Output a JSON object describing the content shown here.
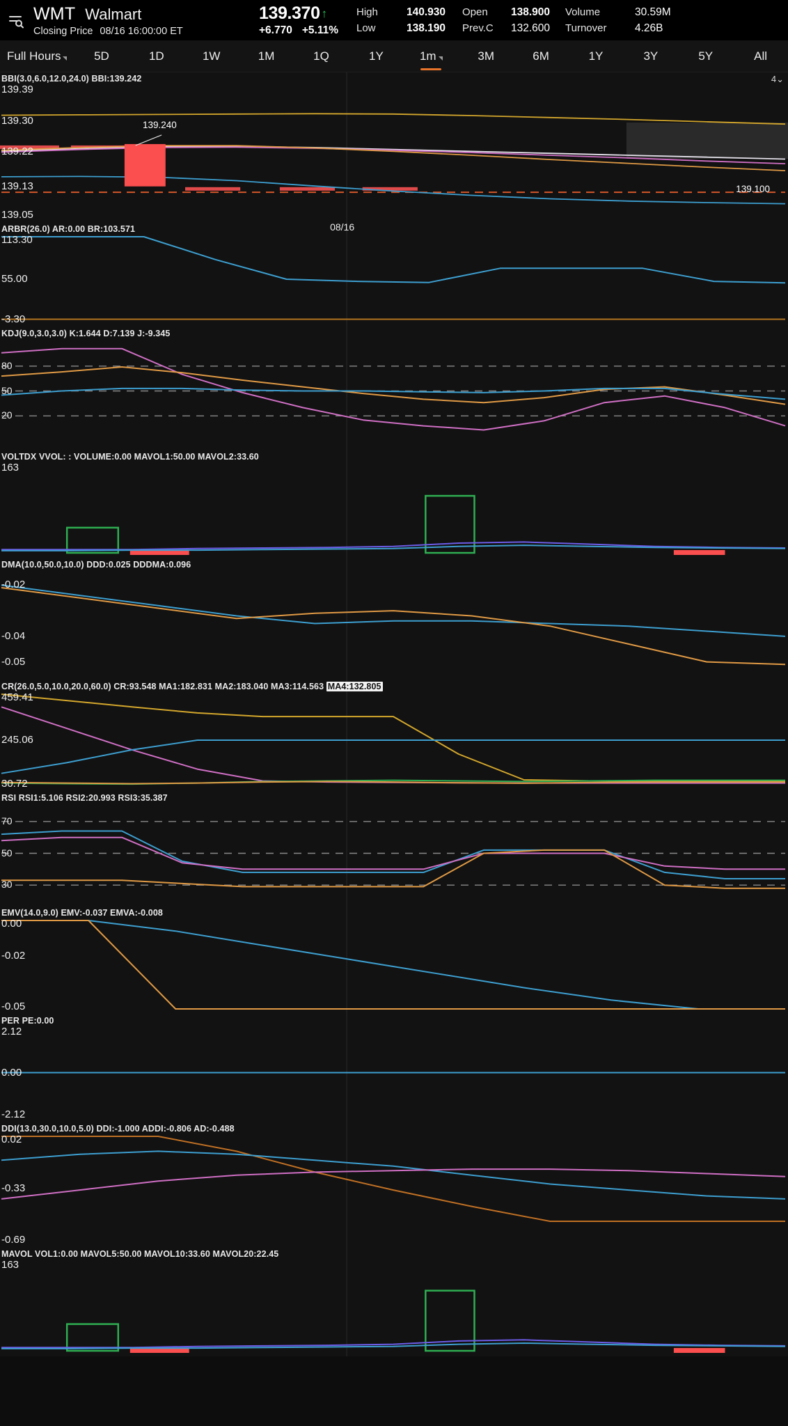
{
  "header": {
    "menu_icon": "menu-search-icon",
    "ticker": "WMT",
    "company": "Walmart",
    "status_label": "Closing Price",
    "timestamp": "08/16 16:00:00 ET",
    "price": "139.370",
    "arrow": "↑",
    "change": "+6.770",
    "change_pct": "+5.11%",
    "up_color": "#25c75a",
    "stats": [
      {
        "label": "High",
        "value": "140.930"
      },
      {
        "label": "Low",
        "value": "138.190"
      },
      {
        "label": "Open",
        "value": "138.900"
      },
      {
        "label": "Prev.C",
        "value": "132.600"
      },
      {
        "label": "Volume",
        "value": "30.59M"
      },
      {
        "label": "Turnover",
        "value": "4.26B"
      }
    ]
  },
  "tabs": {
    "accent": "#e8732a",
    "items": [
      {
        "label": "Full Hours",
        "caret": true,
        "active": false
      },
      {
        "label": "5D",
        "caret": false,
        "active": false
      },
      {
        "label": "1D",
        "caret": false,
        "active": false
      },
      {
        "label": "1W",
        "caret": false,
        "active": false
      },
      {
        "label": "1M",
        "caret": false,
        "active": false
      },
      {
        "label": "1Q",
        "caret": false,
        "active": false
      },
      {
        "label": "1Y",
        "caret": false,
        "active": false
      },
      {
        "label": "1m",
        "caret": true,
        "active": true
      },
      {
        "label": "3M",
        "caret": false,
        "active": false
      },
      {
        "label": "6M",
        "caret": false,
        "active": false
      },
      {
        "label": "1Y",
        "caret": false,
        "active": false
      },
      {
        "label": "3Y",
        "caret": false,
        "active": false
      },
      {
        "label": "5Y",
        "caret": false,
        "active": false
      },
      {
        "label": "All",
        "caret": false,
        "active": false
      }
    ]
  },
  "chart_data": [
    {
      "id": "price",
      "type": "line",
      "title": "BBI(3.0,6.0,12.0,24.0)  BBI:139.242",
      "indicator": "BBI",
      "params": "3.0,6.0,12.0,24.0",
      "readouts": [
        {
          "name": "BBI",
          "value": "139.242"
        }
      ],
      "yticks": [
        "139.39",
        "139.30",
        "139.22",
        "139.13",
        "139.05"
      ],
      "ylim": [
        139.05,
        139.39
      ],
      "grid": false,
      "xlabel": "08/16",
      "annotation": "139.240",
      "axis_badge": "139.100",
      "series": [
        {
          "name": "BBI-upper",
          "color": "#d4a72c",
          "values": [
            139.315,
            139.316,
            139.317,
            139.318,
            139.319,
            139.318,
            139.314,
            139.309,
            139.304,
            139.298,
            139.292
          ]
        },
        {
          "name": "MA-white",
          "color": "#e8e4ee",
          "values": [
            139.222,
            139.228,
            139.233,
            139.234,
            139.231,
            139.226,
            139.221,
            139.216,
            139.211,
            139.206,
            139.201
          ]
        },
        {
          "name": "MA-pink",
          "color": "#cf6fc4",
          "values": [
            139.219,
            139.226,
            139.231,
            139.232,
            139.229,
            139.224,
            139.218,
            139.211,
            139.204,
            139.196,
            139.189
          ]
        },
        {
          "name": "MA-orange",
          "color": "#e09a45",
          "values": [
            139.224,
            139.231,
            139.236,
            139.236,
            139.23,
            139.221,
            139.211,
            139.2,
            139.19,
            139.18,
            139.171
          ]
        },
        {
          "name": "MA-cyan",
          "color": "#3d9fd0",
          "values": [
            139.155,
            139.156,
            139.154,
            139.145,
            139.131,
            139.118,
            139.107,
            139.098,
            139.092,
            139.088,
            139.085
          ]
        }
      ],
      "candle": {
        "color": "#fb4e4e",
        "open": 139.24,
        "close": 139.13
      },
      "dashed_line": {
        "color": "#d4572a",
        "value": 139.115
      }
    },
    {
      "id": "arbr",
      "type": "line",
      "title": "ARBR(26.0)  AR:0.00  BR:103.571",
      "indicator": "ARBR",
      "params": "26.0",
      "readouts": [
        {
          "name": "AR",
          "value": "0.00"
        },
        {
          "name": "BR",
          "value": "103.571"
        }
      ],
      "yticks": [
        "113.30",
        "55.00",
        "-3.30"
      ],
      "ylim": [
        -3.3,
        113.3
      ],
      "series": [
        {
          "name": "BR",
          "color": "#3d9fd0",
          "values": [
            113.3,
            113.3,
            113.3,
            82.0,
            55.0,
            52.0,
            50.5,
            70.0,
            70.0,
            70.0,
            52.0,
            50.0
          ]
        },
        {
          "name": "AR",
          "color": "#b5751f",
          "values": [
            0,
            0,
            0,
            0,
            0,
            0,
            0,
            0,
            0,
            0,
            0,
            0
          ]
        }
      ]
    },
    {
      "id": "kdj",
      "type": "line",
      "title": "KDJ(9.0,3.0,3.0)  K:1.644  D:7.139  J:-9.345",
      "indicator": "KDJ",
      "params": "9.0,3.0,3.0",
      "readouts": [
        {
          "name": "K",
          "value": "1.644"
        },
        {
          "name": "D",
          "value": "7.139"
        },
        {
          "name": "J",
          "value": "-9.345"
        }
      ],
      "yticks": [
        "80",
        "50",
        "20"
      ],
      "ylim": [
        -15,
        110
      ],
      "grid": true,
      "series": [
        {
          "name": "J",
          "color": "#cf6fc4",
          "values": [
            96,
            101,
            101,
            70,
            48,
            30,
            15,
            8,
            3,
            14,
            36,
            44,
            30,
            8
          ]
        },
        {
          "name": "D",
          "color": "#e09a45",
          "values": [
            68,
            73,
            79,
            72,
            63,
            55,
            47,
            40,
            36,
            42,
            52,
            55,
            45,
            34
          ]
        },
        {
          "name": "K",
          "color": "#3d9fd0",
          "values": [
            45,
            50,
            53,
            53,
            51,
            50,
            50,
            49,
            48,
            50,
            53,
            53,
            46,
            40
          ]
        }
      ]
    },
    {
      "id": "voltdx",
      "type": "bar",
      "title": "VOLTDX VVOL: :  VOLUME:0.00  MAVOL1:50.00  MAVOL2:33.60",
      "indicator": "VOLTDX",
      "readouts": [
        {
          "name": "VOLUME",
          "value": "0.00"
        },
        {
          "name": "MAVOL1",
          "value": "50.00"
        },
        {
          "name": "MAVOL2",
          "value": "33.60"
        }
      ],
      "yticks": [
        "163"
      ],
      "ylim": [
        0,
        163
      ],
      "boxes": [
        {
          "x": 0.085,
          "w": 0.065,
          "h": 0.38,
          "color": "#2fae52"
        },
        {
          "x": 0.54,
          "w": 0.062,
          "h": 0.86,
          "color": "#2fae52"
        }
      ],
      "red_bars": [
        {
          "x": 0.165,
          "w": 0.075
        },
        {
          "x": 0.855,
          "w": 0.065
        }
      ],
      "series": [
        {
          "name": "MAVOL1",
          "color": "#6c5ce7",
          "values": [
            6,
            6,
            6,
            8,
            9,
            10,
            12,
            18,
            20,
            16,
            12,
            10,
            9
          ]
        },
        {
          "name": "MAVOL2",
          "color": "#3d9fd0",
          "values": [
            4,
            4,
            5,
            5,
            6,
            7,
            8,
            12,
            14,
            12,
            10,
            9,
            8
          ]
        }
      ]
    },
    {
      "id": "dma",
      "type": "line",
      "title": "DMA(10.0,50.0,10.0)  DDD:0.025  DDDMA:0.096",
      "indicator": "DMA",
      "params": "10.0,50.0,10.0",
      "readouts": [
        {
          "name": "DDD",
          "value": "0.025"
        },
        {
          "name": "DDDMA",
          "value": "0.096"
        }
      ],
      "yticks": [
        "-0.02",
        "-0.04",
        "-0.05"
      ],
      "ylim": [
        -0.055,
        -0.015
      ],
      "series": [
        {
          "name": "DDD",
          "color": "#3d9fd0",
          "values": [
            -0.02,
            -0.024,
            -0.028,
            -0.032,
            -0.035,
            -0.034,
            -0.034,
            -0.035,
            -0.036,
            -0.038,
            -0.04
          ]
        },
        {
          "name": "DDDMA",
          "color": "#e09a45",
          "values": [
            -0.021,
            -0.025,
            -0.029,
            -0.033,
            -0.031,
            -0.03,
            -0.032,
            -0.036,
            -0.043,
            -0.05,
            -0.051
          ]
        }
      ]
    },
    {
      "id": "cr",
      "type": "line",
      "title": "CR(26.0,5.0,10.0,20.0,60.0)  CR:93.548  MA1:182.831  MA2:183.040  MA3:114.563  MA4:132.805",
      "indicator": "CR",
      "params": "26.0,5.0,10.0,20.0,60.0",
      "readouts": [
        {
          "name": "CR",
          "value": "93.548"
        },
        {
          "name": "MA1",
          "value": "182.831"
        },
        {
          "name": "MA2",
          "value": "183.040"
        },
        {
          "name": "MA3",
          "value": "114.563"
        },
        {
          "name": "MA4",
          "value": "132.805",
          "highlight": true
        }
      ],
      "yticks": [
        "459.41",
        "245.06",
        "30.72"
      ],
      "ylim": [
        30.72,
        459.41
      ],
      "series": [
        {
          "name": "MA-gold",
          "color": "#d4a72c",
          "values": [
            459.4,
            430,
            400,
            372,
            355,
            355,
            355,
            180,
            60,
            55,
            55,
            55,
            55
          ]
        },
        {
          "name": "MA-pink",
          "color": "#cf6fc4",
          "values": [
            400,
            300,
            200,
            110,
            55,
            50,
            48,
            46,
            45,
            45,
            45,
            45,
            45
          ]
        },
        {
          "name": "MA-cyan",
          "color": "#3d9fd0",
          "values": [
            90,
            140,
            200,
            245,
            245,
            245,
            245,
            245,
            245,
            245,
            245,
            245,
            245
          ]
        },
        {
          "name": "MA-green",
          "color": "#2fae52",
          "values": [
            45,
            42,
            40,
            45,
            52,
            55,
            58,
            55,
            52,
            55,
            58,
            58,
            58
          ]
        },
        {
          "name": "CR",
          "color": "#e09a45",
          "values": [
            48,
            45,
            42,
            45,
            50,
            52,
            50,
            46,
            44,
            48,
            50,
            50,
            50
          ]
        }
      ]
    },
    {
      "id": "rsi",
      "type": "line",
      "title": "RSI  RSI1:5.106  RSI2:20.993  RSI3:35.387",
      "indicator": "RSI",
      "readouts": [
        {
          "name": "RSI1",
          "value": "5.106"
        },
        {
          "name": "RSI2",
          "value": "20.993"
        },
        {
          "name": "RSI3",
          "value": "35.387"
        }
      ],
      "yticks": [
        "70",
        "50",
        "30"
      ],
      "ylim": [
        20,
        80
      ],
      "grid": true,
      "series": [
        {
          "name": "RSI1",
          "color": "#3d9fd0",
          "values": [
            62,
            64,
            64,
            45,
            38,
            38,
            38,
            38,
            52,
            52,
            52,
            38,
            34,
            34
          ]
        },
        {
          "name": "RSI2",
          "color": "#cf6fc4",
          "values": [
            58,
            60,
            60,
            44,
            40,
            40,
            40,
            40,
            50,
            50,
            50,
            42,
            40,
            40
          ]
        },
        {
          "name": "RSI3",
          "color": "#e09a45",
          "values": [
            33,
            33,
            33,
            31,
            29,
            29,
            29,
            29,
            50,
            52,
            52,
            30,
            28,
            28
          ]
        }
      ]
    },
    {
      "id": "emv",
      "type": "line",
      "title": "EMV(14.0,9.0)  EMV:-0.037  EMVA:-0.008",
      "indicator": "EMV",
      "params": "14.0,9.0",
      "readouts": [
        {
          "name": "EMV",
          "value": "-0.037"
        },
        {
          "name": "EMVA",
          "value": "-0.008"
        }
      ],
      "yticks": [
        "0.00",
        "-0.02",
        "-0.05"
      ],
      "ylim": [
        -0.05,
        0.0
      ],
      "series": [
        {
          "name": "EMV",
          "color": "#3d9fd0",
          "values": [
            0.0,
            0.0,
            -0.006,
            -0.014,
            -0.022,
            -0.03,
            -0.038,
            -0.045,
            -0.05,
            -0.05
          ]
        },
        {
          "name": "EMVA",
          "color": "#e09a45",
          "values": [
            0.0,
            0.0,
            -0.05,
            -0.05,
            -0.05,
            -0.05,
            -0.05,
            -0.05,
            -0.05,
            -0.05
          ]
        }
      ]
    },
    {
      "id": "per",
      "type": "line",
      "title": "PER PE:0.00",
      "indicator": "PER",
      "readouts": [
        {
          "name": "PE",
          "value": "0.00"
        }
      ],
      "yticks": [
        "2.12",
        "0.00",
        "-2.12"
      ],
      "ylim": [
        -2.12,
        2.12
      ],
      "series": [
        {
          "name": "PE",
          "color": "#3d9fd0",
          "values": [
            0,
            0,
            0,
            0,
            0,
            0,
            0,
            0,
            0,
            0
          ]
        }
      ]
    },
    {
      "id": "ddi",
      "type": "line",
      "title": "DDI(13.0,30.0,10.0,5.0)  DDI:-1.000  ADDI:-0.806  AD:-0.488",
      "indicator": "DDI",
      "params": "13.0,30.0,10.0,5.0",
      "readouts": [
        {
          "name": "DDI",
          "value": "-1.000"
        },
        {
          "name": "ADDI",
          "value": "-0.806"
        },
        {
          "name": "AD",
          "value": "-0.488"
        }
      ],
      "yticks": [
        "0.02",
        "-0.33",
        "-0.69"
      ],
      "ylim": [
        -0.69,
        0.02
      ],
      "series": [
        {
          "name": "DDI",
          "color": "#c07024",
          "values": [
            0.02,
            0.02,
            0.02,
            -0.08,
            -0.22,
            -0.34,
            -0.45,
            -0.55,
            -0.55,
            -0.55,
            -0.55
          ]
        },
        {
          "name": "ADDI",
          "color": "#3d9fd0",
          "values": [
            -0.14,
            -0.1,
            -0.08,
            -0.1,
            -0.14,
            -0.18,
            -0.24,
            -0.3,
            -0.34,
            -0.38,
            -0.4
          ]
        },
        {
          "name": "AD",
          "color": "#cf6fc4",
          "values": [
            -0.4,
            -0.34,
            -0.28,
            -0.24,
            -0.22,
            -0.21,
            -0.2,
            -0.2,
            -0.21,
            -0.23,
            -0.25
          ]
        }
      ]
    },
    {
      "id": "mavol",
      "type": "bar",
      "title": "MAVOL  VOL1:0.00  MAVOL5:50.00  MAVOL10:33.60  MAVOL20:22.45",
      "indicator": "MAVOL",
      "readouts": [
        {
          "name": "VOL1",
          "value": "0.00"
        },
        {
          "name": "MAVOL5",
          "value": "50.00"
        },
        {
          "name": "MAVOL10",
          "value": "33.60"
        },
        {
          "name": "MAVOL20",
          "value": "22.45"
        }
      ],
      "yticks": [
        "163"
      ],
      "ylim": [
        0,
        163
      ],
      "boxes": [
        {
          "x": 0.085,
          "w": 0.065,
          "h": 0.4,
          "color": "#2fae52"
        },
        {
          "x": 0.54,
          "w": 0.062,
          "h": 0.9,
          "color": "#2fae52"
        }
      ],
      "red_bars": [
        {
          "x": 0.165,
          "w": 0.075
        },
        {
          "x": 0.855,
          "w": 0.065
        }
      ],
      "series": [
        {
          "name": "MAVOL5",
          "color": "#6c5ce7",
          "values": [
            6,
            6,
            6,
            8,
            9,
            10,
            12,
            18,
            20,
            16,
            12,
            10,
            9
          ]
        },
        {
          "name": "MAVOL10",
          "color": "#3d9fd0",
          "values": [
            4,
            4,
            5,
            5,
            6,
            7,
            8,
            12,
            14,
            12,
            10,
            9,
            8
          ]
        }
      ]
    }
  ],
  "chart_meta": {
    "count_badge": "4",
    "count_caret": "⌄"
  }
}
